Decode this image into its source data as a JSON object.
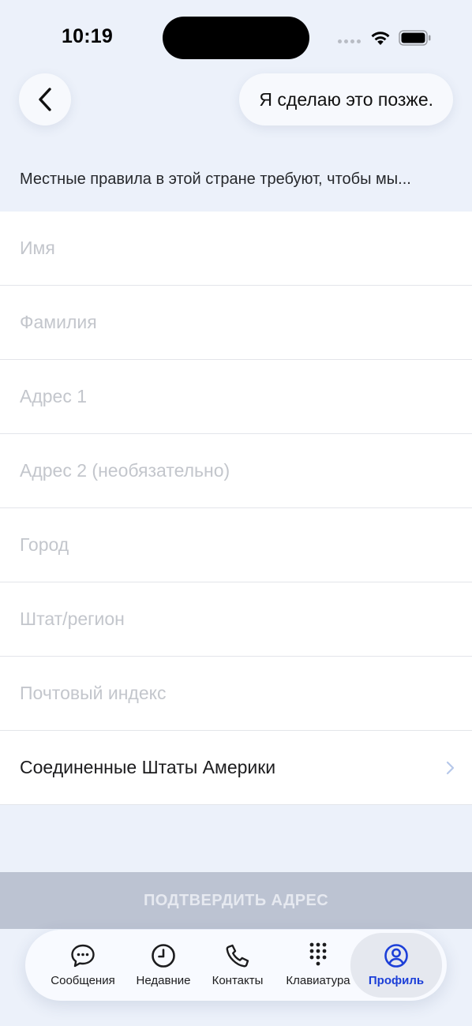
{
  "status_bar": {
    "time": "10:19"
  },
  "header": {
    "back_icon": "chevron-left-icon",
    "later_label": "Я сделаю это позже."
  },
  "intro_text": "Местные правила в этой стране требуют, чтобы мы...",
  "form": {
    "first_name_placeholder": "Имя",
    "last_name_placeholder": "Фамилия",
    "address1_placeholder": "Адрес 1",
    "address2_placeholder": "Адрес 2 (необязательно)",
    "city_placeholder": "Город",
    "state_placeholder": "Штат/регион",
    "zip_placeholder": "Почтовый индекс",
    "country_value": "Соединенные Штаты Америки"
  },
  "confirm_button_label": "ПОДТВЕРДИТЬ АДРЕС",
  "tabs": [
    {
      "label": "Сообщения",
      "icon": "message-bubble-icon"
    },
    {
      "label": "Недавние",
      "icon": "clock-icon"
    },
    {
      "label": "Контакты",
      "icon": "phone-icon"
    },
    {
      "label": "Клавиатура",
      "icon": "keypad-icon"
    },
    {
      "label": "Профиль",
      "icon": "profile-icon"
    }
  ],
  "colors": {
    "background": "#ecf1fa",
    "accent": "#1c3fd8",
    "disabled_button": "#bcc3d2"
  }
}
